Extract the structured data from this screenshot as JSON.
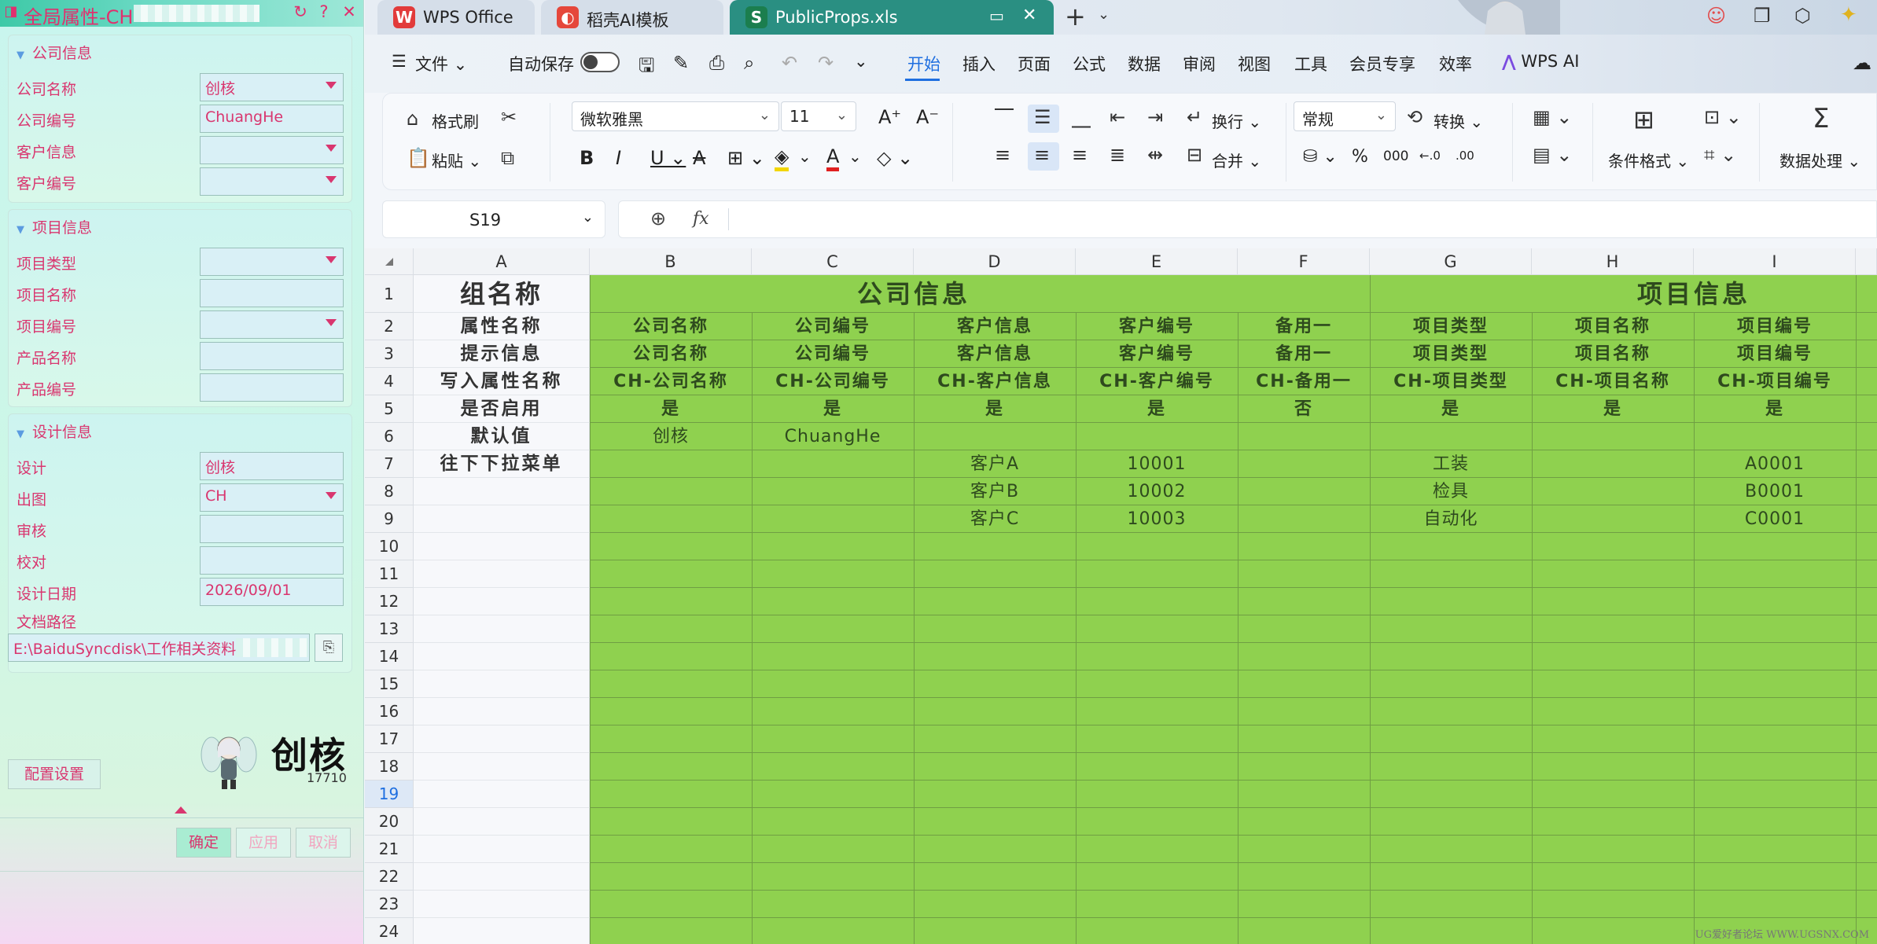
{
  "panel": {
    "title": "全局属性-CH",
    "groups": {
      "company": {
        "title": "公司信息",
        "rows": [
          {
            "label": "公司名称",
            "value": "创核"
          },
          {
            "label": "公司编号",
            "value": "ChuangHe"
          },
          {
            "label": "客户信息",
            "value": ""
          },
          {
            "label": "客户编号",
            "value": ""
          }
        ]
      },
      "project": {
        "title": "项目信息",
        "rows": [
          {
            "label": "项目类型",
            "value": ""
          },
          {
            "label": "项目名称",
            "value": ""
          },
          {
            "label": "项目编号",
            "value": ""
          },
          {
            "label": "产品名称",
            "value": ""
          },
          {
            "label": "产品编号",
            "value": ""
          }
        ]
      },
      "design": {
        "title": "设计信息",
        "rows": [
          {
            "label": "设计",
            "value": "创核"
          },
          {
            "label": "出图",
            "value": "CH"
          },
          {
            "label": "审核",
            "value": ""
          },
          {
            "label": "校对",
            "value": ""
          },
          {
            "label": "设计日期",
            "value": "2026/09/01"
          }
        ],
        "path_label": "文档路径",
        "path_value": "E:\\BaiduSyncdisk\\工作相关资料"
      }
    },
    "config_button": "配置设置",
    "logo_text": "创核",
    "logo_sub": "17710",
    "buttons": {
      "ok": "确定",
      "apply": "应用",
      "cancel": "取消"
    }
  },
  "tabs": [
    {
      "label": "WPS Office",
      "icon": "wps-logo-icon"
    },
    {
      "label": "稻壳AI模板",
      "icon": "docer-icon"
    },
    {
      "label": "PublicProps.xls",
      "icon": "spreadsheet-icon"
    }
  ],
  "menu": {
    "file": "文件",
    "autosave": "自动保存",
    "items": [
      "开始",
      "插入",
      "页面",
      "公式",
      "数据",
      "审阅",
      "视图",
      "工具",
      "会员专享",
      "效率"
    ],
    "wps_ai": "WPS AI"
  },
  "ribbon": {
    "format_painter": "格式刷",
    "paste": "粘贴",
    "font_name": "微软雅黑",
    "font_size": "11",
    "wrap": "换行",
    "merge": "合并",
    "number_format": "常规",
    "convert": "转换",
    "cond_format": "条件格式",
    "data_process": "数据处理"
  },
  "formula_bar": {
    "cell_ref": "S19",
    "fx": "fx",
    "content": ""
  },
  "sheet": {
    "columns": [
      "A",
      "B",
      "C",
      "D",
      "E",
      "F",
      "G",
      "H",
      "I"
    ],
    "row_numbers": [
      "1",
      "2",
      "3",
      "4",
      "5",
      "6",
      "7",
      "8",
      "9",
      "10",
      "11",
      "12",
      "13",
      "14",
      "15",
      "16",
      "17",
      "18",
      "19",
      "20",
      "21",
      "22",
      "23",
      "24"
    ],
    "selected_row": "19",
    "colA": [
      "组名称",
      "属性名称",
      "提示信息",
      "写入属性名称",
      "是否启用",
      "默认值",
      "往下下拉菜单"
    ],
    "merged_headers": {
      "company": "公司信息",
      "project": "项目信息"
    },
    "rows": [
      [
        "公司名称",
        "公司编号",
        "客户信息",
        "客户编号",
        "备用一",
        "项目类型",
        "项目名称",
        "项目编号"
      ],
      [
        "公司名称",
        "公司编号",
        "客户信息",
        "客户编号",
        "备用一",
        "项目类型",
        "项目名称",
        "项目编号"
      ],
      [
        "CH-公司名称",
        "CH-公司编号",
        "CH-客户信息",
        "CH-客户编号",
        "CH-备用一",
        "CH-项目类型",
        "CH-项目名称",
        "CH-项目编号"
      ],
      [
        "是",
        "是",
        "是",
        "是",
        "否",
        "是",
        "是",
        "是"
      ],
      [
        "创核",
        "ChuangHe",
        "",
        "",
        "",
        "",
        "",
        ""
      ],
      [
        "",
        "",
        "客户A",
        "10001",
        "",
        "工装",
        "",
        "A0001"
      ],
      [
        "",
        "",
        "客户B",
        "10002",
        "",
        "检具",
        "",
        "B0001"
      ],
      [
        "",
        "",
        "客户C",
        "10003",
        "",
        "自动化",
        "",
        "C0001"
      ]
    ]
  },
  "watermark": "UG爱好者论坛 WWW.UGSNX.COM",
  "colors": {
    "sheet_green": "#8fd14f",
    "panel_pink": "#d9366f",
    "active_blue": "#1f6fe0",
    "tab_teal": "#2a8f82"
  }
}
